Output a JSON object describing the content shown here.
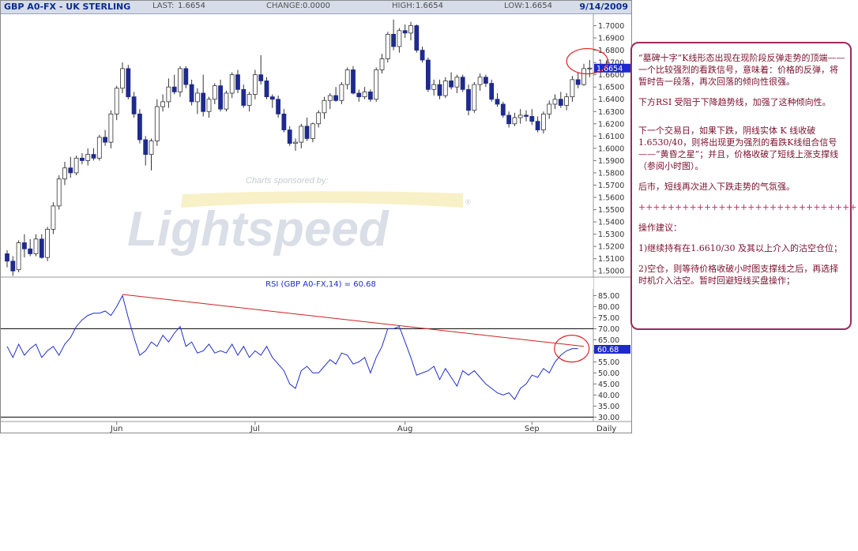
{
  "header": {
    "symbol": "GBP A0-FX - UK STERLING",
    "last_label": "LAST:",
    "last_value": "1.6654",
    "change_label": "CHANGE:",
    "change_value": "0.0000",
    "high_label": "HIGH:",
    "high_value": "1.6654",
    "low_label": "LOW:",
    "low_value": "1.6654",
    "date": "9/14/2009"
  },
  "watermark": {
    "sponsor_text": "Charts sponsored by:",
    "brand": "Lightspeed",
    "registered_mark": "®"
  },
  "price_panel": {
    "y_ticks": [
      "1.7000",
      "1.6900",
      "1.6800",
      "1.6700",
      "1.6600",
      "1.6500",
      "1.6400",
      "1.6300",
      "1.6200",
      "1.6100",
      "1.6000",
      "1.5900",
      "1.5800",
      "1.5700",
      "1.5600",
      "1.5500",
      "1.5400",
      "1.5300",
      "1.5200",
      "1.5100",
      "1.5000"
    ],
    "last_badge": "1.6654"
  },
  "rsi_panel": {
    "title": "RSI (GBP A0-FX,14) = 60.68",
    "y_ticks": [
      "85.00",
      "80.00",
      "75.00",
      "70.00",
      "65.00",
      "60.00",
      "55.00",
      "50.00",
      "45.00",
      "40.00",
      "35.00",
      "30.00"
    ],
    "last_badge": "60.68"
  },
  "x_axis": {
    "labels": [
      "Jun",
      "Jul",
      "Aug",
      "Sep"
    ],
    "period": "Daily"
  },
  "colors": {
    "candle": "#1e2a8c",
    "rsi_line": "#2030c8",
    "trendline": "#d02020",
    "circle": "#e02020",
    "badge": "#1e2acc",
    "note_border": "#9c2a5a",
    "note_text": "#7a1030"
  },
  "chart_data": [
    {
      "type": "candlestick",
      "x_unit": "trading day",
      "x_labels": [
        "Jun",
        "Jul",
        "Aug",
        "Sep"
      ],
      "ylim": [
        1.495,
        1.71
      ],
      "last": 1.6654,
      "ohlc": [
        [
          1.514,
          1.517,
          1.503,
          1.508
        ],
        [
          1.508,
          1.512,
          1.496,
          1.5
        ],
        [
          1.501,
          1.525,
          1.499,
          1.523
        ],
        [
          1.523,
          1.53,
          1.511,
          1.518
        ],
        [
          1.518,
          1.526,
          1.512,
          1.514
        ],
        [
          1.514,
          1.53,
          1.512,
          1.526
        ],
        [
          1.526,
          1.53,
          1.51,
          1.511
        ],
        [
          1.511,
          1.536,
          1.508,
          1.534
        ],
        [
          1.534,
          1.556,
          1.53,
          1.553
        ],
        [
          1.553,
          1.578,
          1.55,
          1.575
        ],
        [
          1.575,
          1.589,
          1.57,
          1.584
        ],
        [
          1.584,
          1.593,
          1.576,
          1.58
        ],
        [
          1.58,
          1.594,
          1.578,
          1.592
        ],
        [
          1.592,
          1.596,
          1.587,
          1.59
        ],
        [
          1.59,
          1.6,
          1.586,
          1.595
        ],
        [
          1.595,
          1.6,
          1.59,
          1.592
        ],
        [
          1.592,
          1.611,
          1.59,
          1.609
        ],
        [
          1.609,
          1.615,
          1.602,
          1.605
        ],
        [
          1.605,
          1.631,
          1.6,
          1.628
        ],
        [
          1.628,
          1.651,
          1.623,
          1.649
        ],
        [
          1.649,
          1.67,
          1.645,
          1.665
        ],
        [
          1.665,
          1.668,
          1.64,
          1.642
        ],
        [
          1.642,
          1.646,
          1.625,
          1.628
        ],
        [
          1.628,
          1.632,
          1.604,
          1.607
        ],
        [
          1.607,
          1.61,
          1.586,
          1.595
        ],
        [
          1.595,
          1.608,
          1.582,
          1.606
        ],
        [
          1.606,
          1.64,
          1.602,
          1.634
        ],
        [
          1.634,
          1.644,
          1.63,
          1.638
        ],
        [
          1.638,
          1.657,
          1.633,
          1.65
        ],
        [
          1.65,
          1.66,
          1.644,
          1.646
        ],
        [
          1.646,
          1.667,
          1.642,
          1.665
        ],
        [
          1.665,
          1.667,
          1.649,
          1.652
        ],
        [
          1.652,
          1.656,
          1.635,
          1.638
        ],
        [
          1.638,
          1.649,
          1.628,
          1.645
        ],
        [
          1.645,
          1.66,
          1.626,
          1.63
        ],
        [
          1.63,
          1.642,
          1.625,
          1.64
        ],
        [
          1.64,
          1.653,
          1.636,
          1.651
        ],
        [
          1.651,
          1.656,
          1.63,
          1.632
        ],
        [
          1.632,
          1.647,
          1.63,
          1.645
        ],
        [
          1.645,
          1.662,
          1.641,
          1.66
        ],
        [
          1.66,
          1.664,
          1.645,
          1.648
        ],
        [
          1.648,
          1.652,
          1.633,
          1.635
        ],
        [
          1.635,
          1.646,
          1.63,
          1.644
        ],
        [
          1.644,
          1.664,
          1.64,
          1.66
        ],
        [
          1.66,
          1.676,
          1.652,
          1.655
        ],
        [
          1.655,
          1.658,
          1.64,
          1.642
        ],
        [
          1.642,
          1.644,
          1.633,
          1.64
        ],
        [
          1.64,
          1.643,
          1.625,
          1.628
        ],
        [
          1.628,
          1.632,
          1.613,
          1.615
        ],
        [
          1.615,
          1.618,
          1.602,
          1.604
        ],
        [
          1.604,
          1.608,
          1.598,
          1.605
        ],
        [
          1.605,
          1.62,
          1.6,
          1.618
        ],
        [
          1.618,
          1.625,
          1.606,
          1.608
        ],
        [
          1.608,
          1.621,
          1.605,
          1.62
        ],
        [
          1.62,
          1.631,
          1.617,
          1.629
        ],
        [
          1.629,
          1.642,
          1.624,
          1.639
        ],
        [
          1.639,
          1.645,
          1.632,
          1.643
        ],
        [
          1.643,
          1.65,
          1.638,
          1.639
        ],
        [
          1.639,
          1.654,
          1.636,
          1.652
        ],
        [
          1.652,
          1.666,
          1.648,
          1.664
        ],
        [
          1.664,
          1.667,
          1.644,
          1.645
        ],
        [
          1.645,
          1.648,
          1.638,
          1.642
        ],
        [
          1.642,
          1.65,
          1.64,
          1.646
        ],
        [
          1.646,
          1.648,
          1.638,
          1.64
        ],
        [
          1.64,
          1.666,
          1.638,
          1.664
        ],
        [
          1.664,
          1.677,
          1.661,
          1.673
        ],
        [
          1.673,
          1.695,
          1.67,
          1.693
        ],
        [
          1.693,
          1.705,
          1.68,
          1.683
        ],
        [
          1.683,
          1.698,
          1.678,
          1.696
        ],
        [
          1.696,
          1.701,
          1.69,
          1.694
        ],
        [
          1.694,
          1.703,
          1.688,
          1.7
        ],
        [
          1.7,
          1.701,
          1.678,
          1.68
        ],
        [
          1.68,
          1.683,
          1.67,
          1.672
        ],
        [
          1.672,
          1.674,
          1.646,
          1.648
        ],
        [
          1.648,
          1.656,
          1.643,
          1.652
        ],
        [
          1.652,
          1.656,
          1.64,
          1.643
        ],
        [
          1.643,
          1.658,
          1.641,
          1.655
        ],
        [
          1.655,
          1.662,
          1.648,
          1.65
        ],
        [
          1.65,
          1.66,
          1.645,
          1.658
        ],
        [
          1.658,
          1.66,
          1.646,
          1.648
        ],
        [
          1.648,
          1.652,
          1.627,
          1.631
        ],
        [
          1.631,
          1.654,
          1.629,
          1.652
        ],
        [
          1.652,
          1.661,
          1.647,
          1.658
        ],
        [
          1.658,
          1.66,
          1.65,
          1.653
        ],
        [
          1.653,
          1.656,
          1.638,
          1.64
        ],
        [
          1.64,
          1.645,
          1.634,
          1.636
        ],
        [
          1.636,
          1.638,
          1.625,
          1.627
        ],
        [
          1.627,
          1.63,
          1.617,
          1.62
        ],
        [
          1.62,
          1.629,
          1.618,
          1.625
        ],
        [
          1.625,
          1.632,
          1.62,
          1.627
        ],
        [
          1.627,
          1.631,
          1.622,
          1.626
        ],
        [
          1.626,
          1.632,
          1.619,
          1.622
        ],
        [
          1.622,
          1.626,
          1.613,
          1.615
        ],
        [
          1.615,
          1.63,
          1.612,
          1.628
        ],
        [
          1.628,
          1.639,
          1.624,
          1.636
        ],
        [
          1.636,
          1.644,
          1.632,
          1.64
        ],
        [
          1.64,
          1.646,
          1.633,
          1.635
        ],
        [
          1.635,
          1.645,
          1.631,
          1.642
        ],
        [
          1.642,
          1.659,
          1.638,
          1.656
        ],
        [
          1.656,
          1.662,
          1.649,
          1.652
        ],
        [
          1.652,
          1.669,
          1.651,
          1.665
        ],
        [
          1.665,
          1.672,
          1.658,
          1.6654
        ]
      ]
    },
    {
      "type": "line",
      "title": "RSI (GBP A0-FX,14) = 60.68",
      "ylim": [
        28,
        88
      ],
      "last": 60.68,
      "values": [
        62,
        57,
        63,
        58,
        61,
        63,
        57,
        60,
        62,
        58,
        63,
        66,
        71,
        74,
        76,
        77,
        77,
        78,
        76,
        80,
        85,
        75,
        66,
        58,
        60,
        64,
        62,
        67,
        64,
        68,
        71,
        62,
        64,
        59,
        60,
        63,
        59,
        60,
        59,
        63,
        58,
        62,
        57,
        60,
        58,
        62,
        57,
        54,
        51,
        45,
        43,
        51,
        53,
        50,
        50,
        53,
        56,
        54,
        59,
        58,
        54,
        55,
        57,
        50,
        57,
        62,
        70,
        70,
        71,
        64,
        57,
        49,
        50,
        51,
        53,
        47,
        52,
        48,
        44,
        51,
        49,
        51,
        48,
        45,
        43,
        41,
        40,
        41,
        38,
        43,
        45,
        49,
        48,
        52,
        50,
        55,
        58,
        60,
        61,
        61
      ],
      "trendline": {
        "from_index": 20,
        "from_value": 85.5,
        "to_index": 100,
        "to_value": 62
      }
    }
  ],
  "annotation": {
    "paragraphs": [
      "“墓碑十字”K线形态出现在现阶段反弹走势的顶端——一个比较强烈的看跌信号，意味着：价格的反弹，将暂时告一段落，再次回落的倾向性很强。",
      "下方RSI 受阻于下降趋势线，加强了这种倾向性。",
      "下一个交易日，如果下跌，阴线实体 K 线收破1.6530/40，则将出现更为强烈的看跌K线组合信号——“黄昏之星”；并且，价格收破了短线上涨支撑线（参阅小时图）。",
      "后市，短线再次进入下跌走势的气氛强。",
      "++++++++++++++++++++++++++++++",
      "操作建议：",
      "1)继续持有在1.6610/30 及其以上介入的沽空仓位；",
      "2)空仓，则等待价格收破小时图支撑线之后，再选择时机介入沽空。暂时回避短线买盘操作；"
    ]
  }
}
